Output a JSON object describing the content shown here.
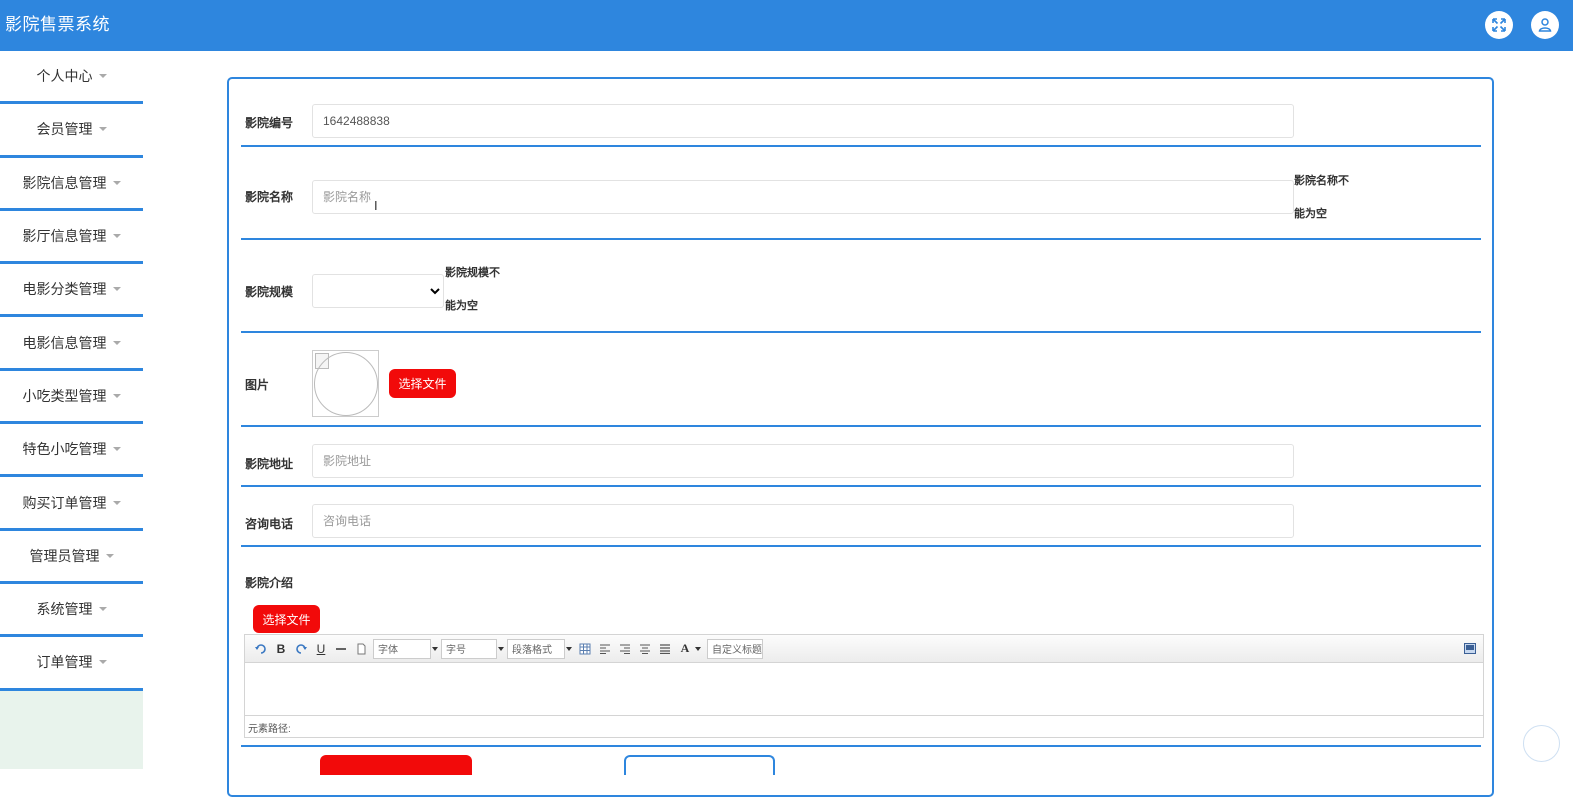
{
  "header": {
    "title": "影院售票系统",
    "fullscreen_icon": "expand-icon",
    "user_icon": "user-icon",
    "color": "#2e86de"
  },
  "sidebar": {
    "items": [
      {
        "label": "个人中心"
      },
      {
        "label": "会员管理"
      },
      {
        "label": "影院信息管理"
      },
      {
        "label": "影厅信息管理"
      },
      {
        "label": "电影分类管理"
      },
      {
        "label": "电影信息管理"
      },
      {
        "label": "小吃类型管理"
      },
      {
        "label": "特色小吃管理"
      },
      {
        "label": "购买订单管理"
      },
      {
        "label": "管理员管理"
      },
      {
        "label": "系统管理"
      },
      {
        "label": "订单管理"
      }
    ]
  },
  "form": {
    "cinema_id": {
      "label": "影院编号",
      "value": "1642488838"
    },
    "cinema_name": {
      "label": "影院名称",
      "placeholder": "影院名称",
      "error_line1": "影院名称不",
      "error_line2": "能为空"
    },
    "cinema_scale": {
      "label": "影院规模",
      "value": "",
      "error_line1": "影院规模不",
      "error_line2": "能为空"
    },
    "image": {
      "label": "图片",
      "upload_button": "选择文件"
    },
    "address": {
      "label": "影院地址",
      "placeholder": "影院地址"
    },
    "phone": {
      "label": "咨询电话",
      "placeholder": "咨询电话"
    },
    "intro": {
      "label": "影院介绍",
      "upload_button": "选择文件"
    }
  },
  "editor": {
    "font_family": "字体",
    "font_size": "字号",
    "paragraph": "段落格式",
    "custom_title": "自定义标题",
    "path_label": "元素路径:",
    "bold": "B",
    "underline": "U",
    "font_color": "A"
  },
  "colors": {
    "accent": "#2e86de",
    "danger": "#f20a0a",
    "sidebar_bg": "#e8f3ec"
  }
}
